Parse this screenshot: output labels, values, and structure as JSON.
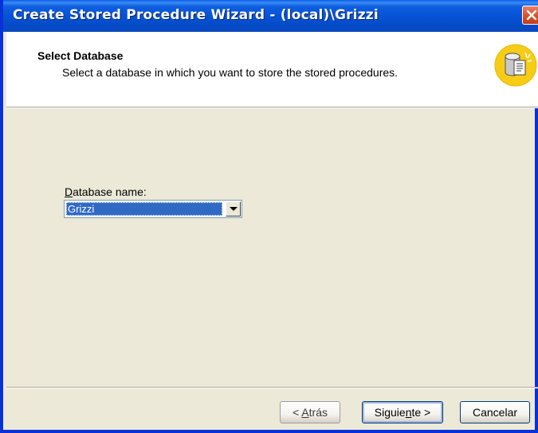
{
  "window": {
    "title": "Create Stored Procedure Wizard - (local)\\Grizzi"
  },
  "header": {
    "title": "Select Database",
    "subtitle": "Select a database in which you want to store the stored procedures.",
    "icon": "database-wizard-icon"
  },
  "database": {
    "label_prefix": "",
    "label_accel": "D",
    "label_rest": "atabase name:",
    "selected": "Grizzi"
  },
  "buttons": {
    "back_prefix": "< ",
    "back_accel": "A",
    "back_rest": "trás",
    "next_prefix": "Siguie",
    "next_accel": "n",
    "next_rest": "te >",
    "cancel": "Cancelar"
  },
  "colors": {
    "titlebar": "#0653d6",
    "selection": "#316ac5",
    "dialog_bg": "#ece9d8"
  }
}
